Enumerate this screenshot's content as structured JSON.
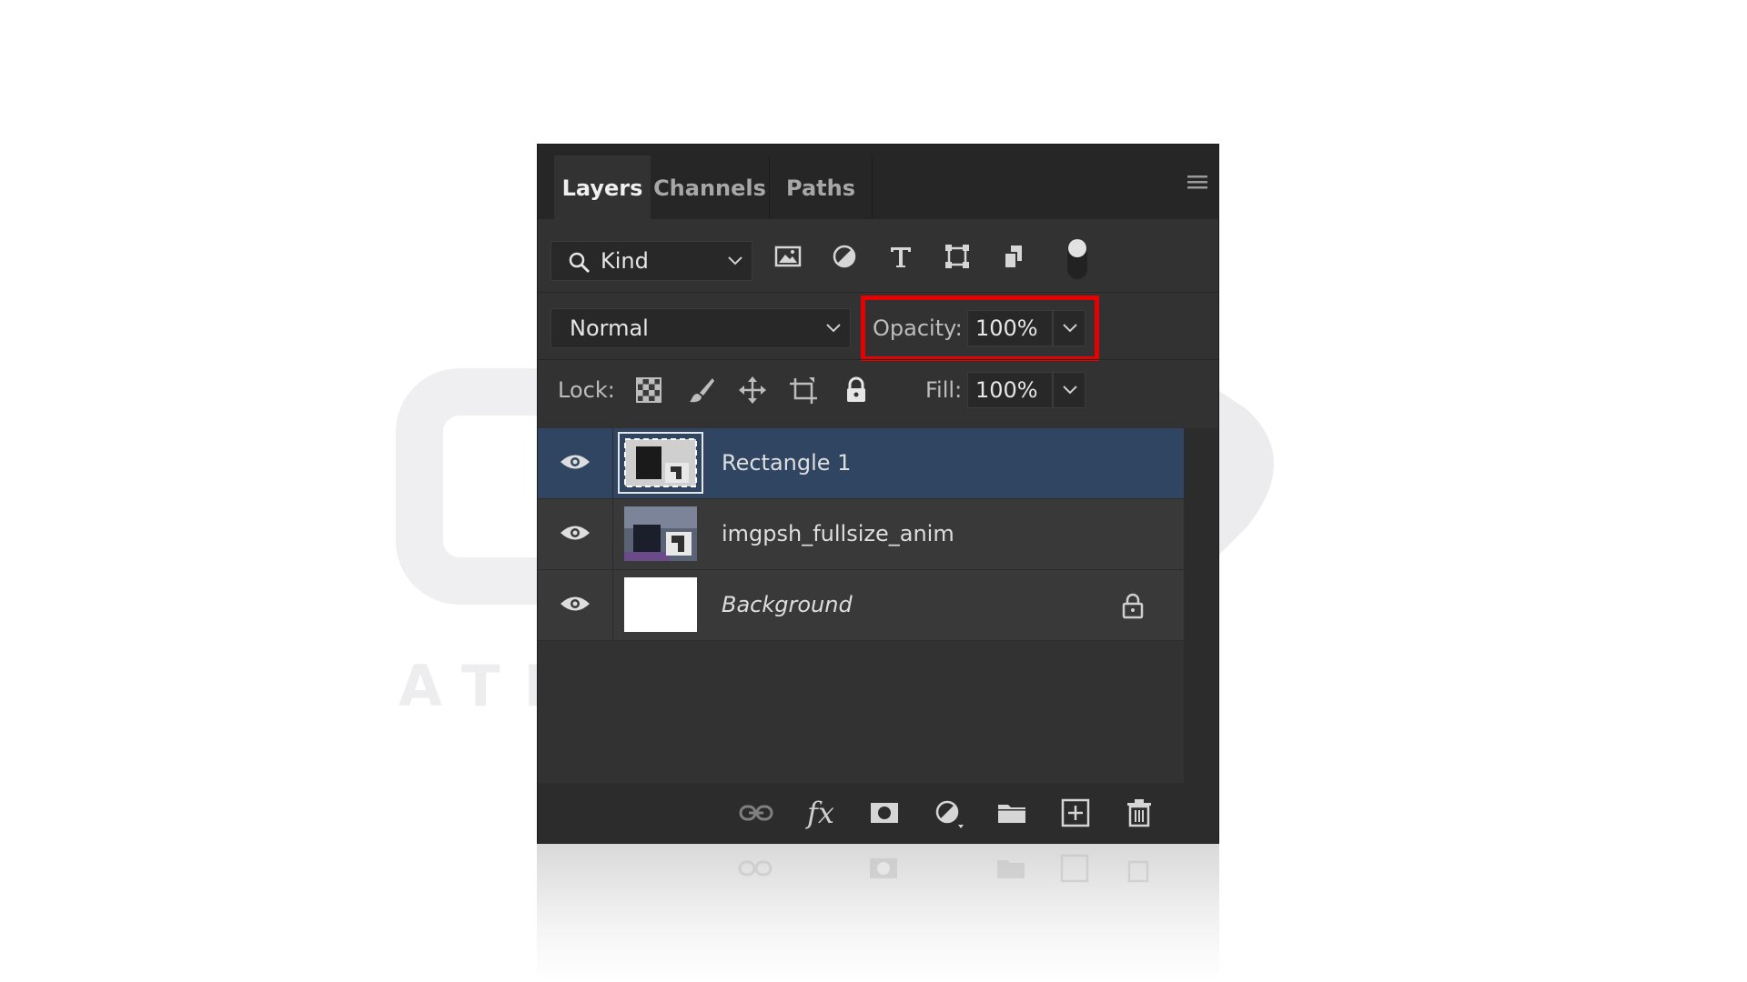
{
  "watermark": {
    "text": "ATRIN ACADEMY"
  },
  "panel": {
    "tabs": [
      {
        "label": "Layers",
        "active": true
      },
      {
        "label": "Channels",
        "active": false
      },
      {
        "label": "Paths",
        "active": false
      }
    ],
    "menu_icon": "hamburger-icon"
  },
  "filter": {
    "kind_label": "Kind",
    "icons": [
      "image-filter-icon",
      "adjustment-filter-icon",
      "type-filter-icon",
      "shape-filter-icon",
      "smart-object-filter-icon"
    ],
    "toggle_on": true
  },
  "blend": {
    "mode": "Normal",
    "opacity_label": "Opacity:",
    "opacity_value": "100%"
  },
  "lock": {
    "label": "Lock:",
    "icons": [
      "lock-transparent-pixels-icon",
      "lock-image-pixels-icon",
      "lock-position-icon",
      "lock-artboard-icon",
      "lock-all-icon"
    ],
    "fill_label": "Fill:",
    "fill_value": "100%"
  },
  "layers": [
    {
      "name": "Rectangle 1",
      "selected": true,
      "visible": true,
      "type": "smart-object"
    },
    {
      "name": "imgpsh_fullsize_anim",
      "selected": false,
      "visible": true,
      "type": "smart-object"
    },
    {
      "name": "Background",
      "selected": false,
      "visible": true,
      "locked": true,
      "type": "background"
    }
  ],
  "footer_tools": [
    "link-layers-icon",
    "fx-icon",
    "add-mask-icon",
    "adjustment-layer-icon",
    "group-folder-icon",
    "new-layer-icon",
    "trash-icon"
  ],
  "colors": {
    "panel_bg": "#323232",
    "selected_layer": "#304562",
    "highlight": "#e60000"
  }
}
